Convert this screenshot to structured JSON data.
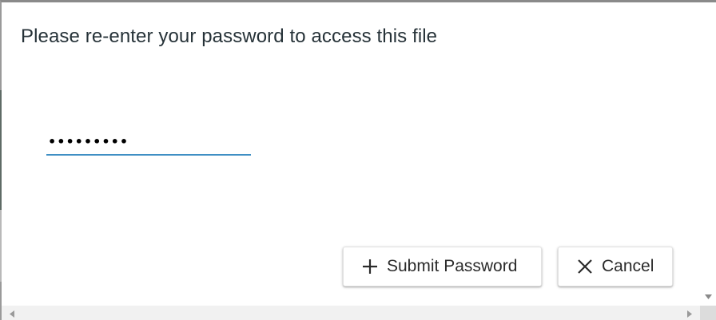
{
  "dialog": {
    "title": "Please re-enter your password to access this file"
  },
  "password": {
    "value": "•••••••••"
  },
  "buttons": {
    "submit_label": "Submit Password",
    "submit_icon": "plus-icon",
    "cancel_label": "Cancel",
    "cancel_icon": "close-icon"
  },
  "colors": {
    "field_underline": "#3f8fc4",
    "title_text": "#263238",
    "button_text": "#2b2b2b"
  }
}
